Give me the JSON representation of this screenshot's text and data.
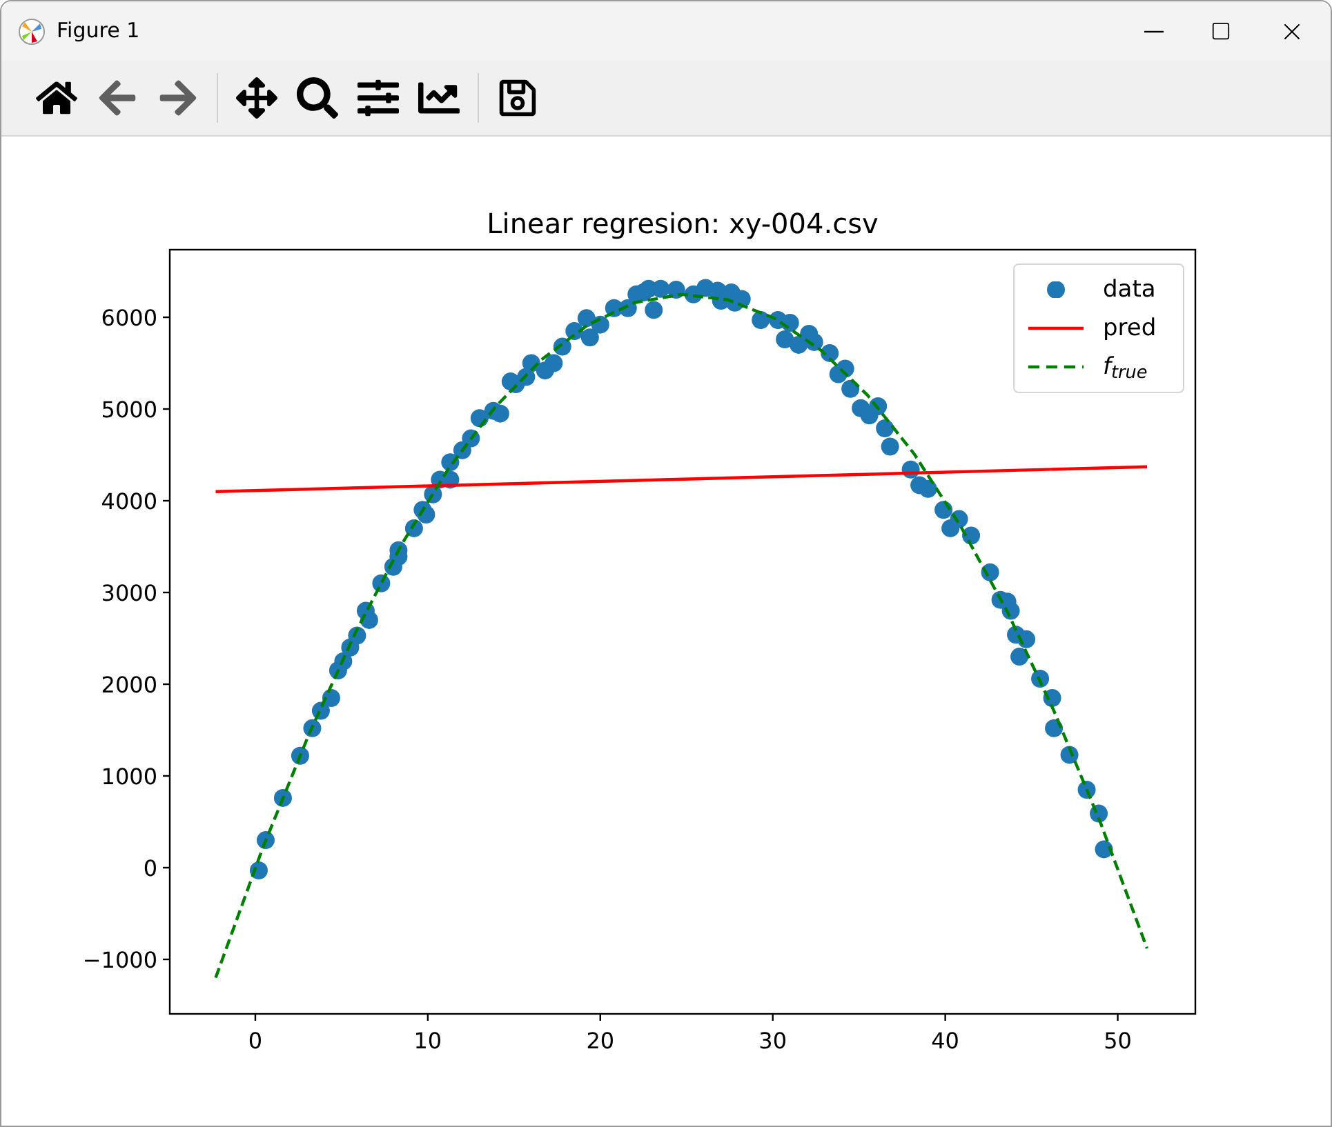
{
  "window": {
    "title": "Figure 1"
  },
  "toolbar": {
    "buttons": [
      {
        "kind": "home",
        "disabled": false
      },
      {
        "kind": "back",
        "disabled": true
      },
      {
        "kind": "forward",
        "disabled": true
      },
      {
        "kind": "pan",
        "disabled": false
      },
      {
        "kind": "zoom",
        "disabled": false
      },
      {
        "kind": "subplots",
        "disabled": false
      },
      {
        "kind": "axes",
        "disabled": false
      },
      {
        "kind": "save",
        "disabled": false
      }
    ]
  },
  "figure": {
    "chart_data": {
      "type": "scatter",
      "legend": true,
      "title": "Linear regresion: xy-004.csv",
      "xlim": [
        -4.96,
        54.5
      ],
      "ylim": [
        -1594,
        6737
      ],
      "xticks": [
        0,
        10,
        20,
        30,
        40,
        50
      ],
      "yticks": [
        {
          "value": -1000,
          "label": "−1000"
        },
        0,
        1000,
        2000,
        3000,
        4000,
        5000,
        6000
      ],
      "series": [
        {
          "name": "data",
          "color": "#1f77b4",
          "x": [
            0.2,
            0.6,
            1.6,
            2.6,
            3.3,
            3.8,
            4.4,
            4.8,
            5.1,
            5.5,
            5.9,
            6.4,
            6.6,
            7.3,
            8.0,
            8.3,
            8.3,
            9.2,
            9.7,
            9.9,
            10.3,
            10.7,
            11.3,
            11.3,
            12.0,
            12.5,
            13.0,
            13.8,
            14.2,
            14.8,
            15.1,
            15.7,
            16.0,
            16.8,
            17.3,
            17.8,
            18.5,
            19.2,
            19.4,
            20.0,
            20.8,
            21.6,
            22.1,
            22.5,
            22.8,
            23.1,
            23.5,
            24.4,
            25.4,
            26.1,
            26.8,
            27.0,
            27.6,
            27.8,
            28.2,
            29.3,
            30.3,
            30.7,
            31.0,
            31.5,
            32.1,
            32.4,
            33.3,
            33.8,
            34.2,
            34.5,
            35.1,
            35.6,
            36.1,
            36.5,
            36.8,
            38.0,
            38.5,
            39.0,
            39.9,
            40.3,
            40.8,
            41.5,
            42.6,
            43.2,
            43.6,
            43.8,
            44.1,
            44.3,
            44.7,
            45.5,
            46.2,
            46.3,
            47.2,
            48.2,
            48.9,
            49.2
          ],
          "values": [
            -30,
            300,
            760,
            1220,
            1520,
            1710,
            1850,
            2150,
            2250,
            2400,
            2530,
            2800,
            2700,
            3100,
            3280,
            3460,
            3390,
            3700,
            3900,
            3850,
            4070,
            4230,
            4420,
            4230,
            4550,
            4680,
            4900,
            4980,
            4950,
            5300,
            5270,
            5350,
            5500,
            5420,
            5500,
            5680,
            5850,
            5990,
            5780,
            5920,
            6100,
            6100,
            6250,
            6270,
            6310,
            6080,
            6310,
            6300,
            6250,
            6320,
            6290,
            6180,
            6270,
            6160,
            6200,
            5970,
            5970,
            5760,
            5940,
            5700,
            5820,
            5730,
            5610,
            5380,
            5440,
            5220,
            5010,
            4930,
            5030,
            4790,
            4590,
            4340,
            4170,
            4130,
            3900,
            3700,
            3800,
            3620,
            3220,
            2920,
            2900,
            2800,
            2540,
            2300,
            2490,
            2060,
            1850,
            1520,
            1230,
            850,
            590,
            200
          ]
        },
        {
          "name": "pred",
          "type": "line",
          "line_style": "solid",
          "color": "#ff0000",
          "x": [
            -2.3,
            51.7
          ],
          "values": [
            4100,
            4370
          ]
        },
        {
          "name": "f$_{true}$",
          "type": "line",
          "line_style": "dashed",
          "color": "#008000",
          "x": [
            -2.3,
            0.4,
            3.1,
            5.8,
            8.5,
            11.2,
            13.9,
            16.6,
            19.3,
            22,
            24.7,
            27.4,
            30.1,
            32.8,
            35.5,
            38.2,
            40.9,
            43.6,
            46.3,
            49,
            51.7
          ],
          "values": [
            -1200,
            200,
            1450,
            2560,
            3530,
            4350,
            5020,
            5540,
            5920,
            6160,
            6250,
            6190,
            5990,
            5640,
            5150,
            4510,
            3720,
            2790,
            1710,
            490,
            -880
          ]
        }
      ]
    }
  }
}
